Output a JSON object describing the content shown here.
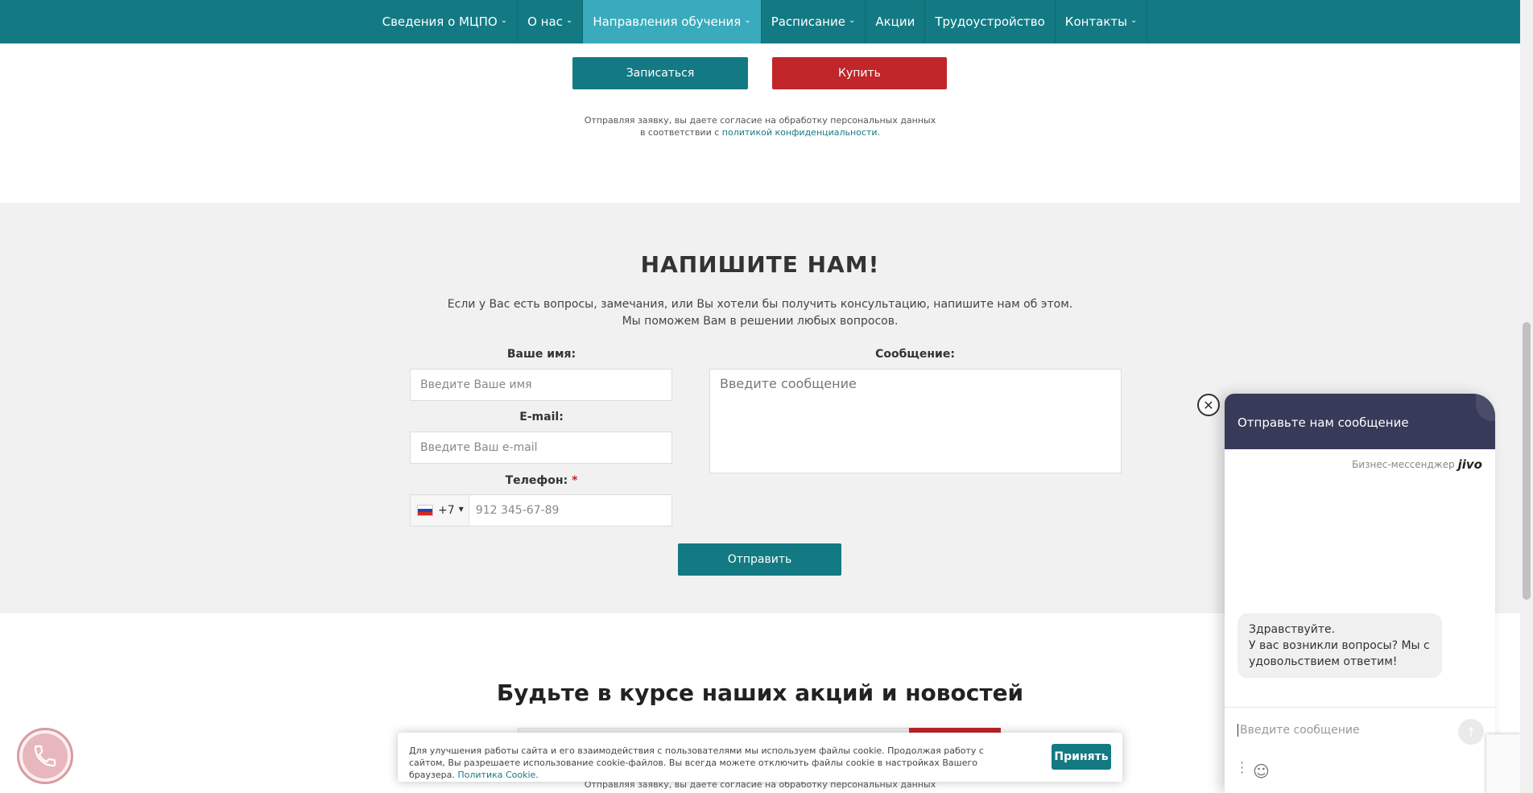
{
  "nav": {
    "items": [
      {
        "label": "Сведения о МЦПО",
        "dropdown": true
      },
      {
        "label": "О нас",
        "dropdown": true
      },
      {
        "label": "Направления обучения",
        "dropdown": true,
        "active": true
      },
      {
        "label": "Расписание",
        "dropdown": true
      },
      {
        "label": "Акции",
        "dropdown": false
      },
      {
        "label": "Трудоустройство",
        "dropdown": false
      },
      {
        "label": "Контакты",
        "dropdown": true
      }
    ]
  },
  "top": {
    "enroll_label": "Записаться",
    "buy_label": "Купить",
    "consent_line1": "Отправляя заявку, вы даете согласие на обработку персональных данных",
    "consent_line2_prefix": "в соответствии с ",
    "consent_link": "политикой конфиденциальности",
    "consent_line2_suffix": "."
  },
  "contact": {
    "title": "НАПИШИТЕ НАМ!",
    "subtitle_line1": "Если у Вас есть вопросы, замечания, или Вы хотели бы получить консультацию, напишите нам об этом.",
    "subtitle_line2": "Мы поможем Вам в решении любых вопросов.",
    "name_label": "Ваше имя:",
    "name_placeholder": "Введите Ваше имя",
    "email_label": "E-mail:",
    "email_placeholder": "Введите Ваш e-mail",
    "phone_label": "Телефон:",
    "phone_required": "*",
    "phone_code": "+7",
    "phone_placeholder": "912 345-67-89",
    "message_label": "Сообщение:",
    "message_placeholder": "Введите сообщение",
    "send_label": "Отправить"
  },
  "news": {
    "title": "Будьте в курсе наших акций и новостей",
    "consent": "Отправляя заявку, вы даете согласие на обработку персональных данных"
  },
  "cookie": {
    "text": "Для улучшения работы сайта и его взаимодействия с пользователями мы используем файлы cookie. Продолжая работу с сайтом, Вы разрешаете использование cookie-файлов. Вы всегда можете отключить файлы cookie в настройках Вашего браузера. ",
    "link": "Политика Cookie",
    "link_suffix": ".",
    "accept_label": "Принять"
  },
  "chat": {
    "header": "Отправьте нам сообщение",
    "brand_prefix": "Бизнес-мессенджер",
    "brand_name": "jivo",
    "greeting_line1": "Здравствуйте.",
    "greeting_line2": "У вас возникли вопросы? Мы с удовольствием ответим!",
    "input_placeholder": "Введите сообщение",
    "close_icon": "close-icon",
    "send_icon": "arrow-up-icon",
    "menu_icon": "more-vertical-icon",
    "emoji_icon": "smiley-icon"
  },
  "widgets": {
    "phone_icon": "phone-icon"
  },
  "colors": {
    "nav_bg": "#137a84",
    "nav_active": "#3aabbd",
    "accent_red": "#c0262a",
    "section_gray": "#f1f1f1",
    "chat_header": "#383a59"
  }
}
